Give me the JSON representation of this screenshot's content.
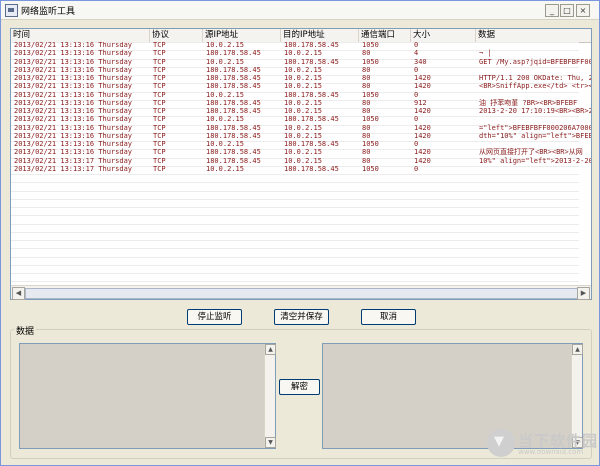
{
  "window": {
    "title": "网络监听工具",
    "minimize_label": "_",
    "maximize_label": "□",
    "close_label": "×"
  },
  "table": {
    "columns": [
      "时间",
      "协议",
      "源IP地址",
      "目的IP地址",
      "通信端口",
      "大小",
      "数据"
    ],
    "rows": [
      [
        "2013/02/21 13:13:16 Thursday",
        "TCP",
        "10.0.2.15",
        "180.178.58.45",
        "1050",
        "0",
        ""
      ],
      [
        "2013/02/21 13:13:16 Thursday",
        "TCP",
        "180.178.58.45",
        "10.0.2.15",
        "80",
        "4",
        "¬ |"
      ],
      [
        "2013/02/21 13:13:16 Thursday",
        "TCP",
        "10.0.2.15",
        "180.178.58.45",
        "1050",
        "340",
        "GET /My.asp?jqid=BFEBFBFF00"
      ],
      [
        "2013/02/21 13:13:16 Thursday",
        "TCP",
        "180.178.58.45",
        "10.0.2.15",
        "80",
        "0",
        ""
      ],
      [
        "2013/02/21 13:13:16 Thursday",
        "TCP",
        "180.178.58.45",
        "10.0.2.15",
        "80",
        "1420",
        "HTTP/1.1 200 OKDate: Thu, 2"
      ],
      [
        "2013/02/21 13:13:16 Thursday",
        "TCP",
        "180.178.58.45",
        "10.0.2.15",
        "80",
        "1420",
        "<BR>SniffApp.exe</td> <tr><"
      ],
      [
        "2013/02/21 13:13:16 Thursday",
        "TCP",
        "10.0.2.15",
        "180.178.58.45",
        "1050",
        "0",
        ""
      ],
      [
        "2013/02/21 13:13:16 Thursday",
        "TCP",
        "180.178.58.45",
        "10.0.2.15",
        "80",
        "912",
        "油  抒苯吻堇  ?BR><BR>BFEBF"
      ],
      [
        "2013/02/21 13:13:16 Thursday",
        "TCP",
        "180.178.58.45",
        "10.0.2.15",
        "80",
        "1420",
        "2013-2-20 17:10:19<BR><BR>2"
      ],
      [
        "2013/02/21 13:13:16 Thursday",
        "TCP",
        "10.0.2.15",
        "180.178.58.45",
        "1050",
        "0",
        ""
      ],
      [
        "2013/02/21 13:13:16 Thursday",
        "TCP",
        "180.178.58.45",
        "10.0.2.15",
        "80",
        "1420",
        "=\"left\">BFEBFBFF000206A7000"
      ],
      [
        "2013/02/21 13:13:16 Thursday",
        "TCP",
        "180.178.58.45",
        "10.0.2.15",
        "80",
        "1420",
        "dth=\"10%\" align=\"left\">BFEB"
      ],
      [
        "2013/02/21 13:13:16 Thursday",
        "TCP",
        "10.0.2.15",
        "180.178.58.45",
        "1050",
        "0",
        ""
      ],
      [
        "2013/02/21 13:13:16 Thursday",
        "TCP",
        "180.178.58.45",
        "10.0.2.15",
        "80",
        "1420",
        "从网页直接打开了<BR><BR>从网"
      ],
      [
        "2013/02/21 13:13:17 Thursday",
        "TCP",
        "180.178.58.45",
        "10.0.2.15",
        "80",
        "1420",
        "10%\" align=\"left\">2013-2-20"
      ],
      [
        "2013/02/21 13:13:17 Thursday",
        "TCP",
        "10.0.2.15",
        "180.178.58.45",
        "1050",
        "0",
        ""
      ]
    ]
  },
  "scroll": {
    "left_arrow": "◀",
    "right_arrow": "▶",
    "up_arrow": "▲",
    "down_arrow": "▼"
  },
  "buttons": {
    "stop": "停止监听",
    "clear_save": "清空并保存",
    "cancel": "取消",
    "decrypt": "解密"
  },
  "data_group": {
    "title": "数据"
  },
  "watermark": {
    "text": "当下软件园",
    "url": "www.downxia.com"
  },
  "colors": {
    "row_text": "#8a1a1a",
    "textarea_bg": "#d4d0c8",
    "window_bg": "#ece9d8"
  }
}
